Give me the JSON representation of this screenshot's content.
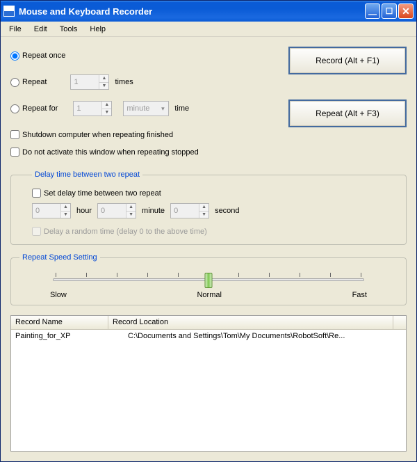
{
  "window": {
    "title": "Mouse and Keyboard Recorder"
  },
  "menu": {
    "file": "File",
    "edit": "Edit",
    "tools": "Tools",
    "help": "Help"
  },
  "repeat": {
    "once_label": "Repeat once",
    "repeat_label": "Repeat",
    "repeat_times_value": "1",
    "repeat_times_suffix": "times",
    "repeat_for_label": "Repeat for",
    "repeat_for_value": "1",
    "repeat_for_unit": "minute",
    "repeat_for_suffix": "time"
  },
  "buttons": {
    "record": "Record (Alt + F1)",
    "repeat": "Repeat (Alt + F3)"
  },
  "checks": {
    "shutdown": "Shutdown computer when repeating finished",
    "no_activate": "Do not activate this window when repeating stopped"
  },
  "delay": {
    "legend": "Delay time between two repeat",
    "set_label": "Set delay time between two repeat",
    "hour_value": "0",
    "hour_label": "hour",
    "minute_value": "0",
    "minute_label": "minute",
    "second_value": "0",
    "second_label": "second",
    "random_label": "Delay a random time (delay 0 to the above time)"
  },
  "speed": {
    "legend": "Repeat Speed Setting",
    "slow": "Slow",
    "normal": "Normal",
    "fast": "Fast"
  },
  "list": {
    "col_name": "Record Name",
    "col_location": "Record Location",
    "rows": [
      {
        "name": "Painting_for_XP",
        "location": "C:\\Documents and Settings\\Tom\\My Documents\\RobotSoft\\Re..."
      }
    ]
  }
}
